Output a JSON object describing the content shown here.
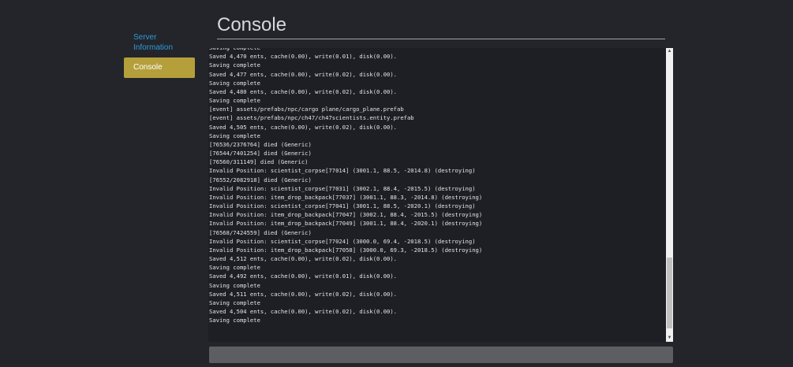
{
  "sidebar": {
    "items": [
      {
        "label": "Server Information",
        "active": false
      },
      {
        "label": "Console",
        "active": true
      }
    ]
  },
  "page": {
    "title": "Console"
  },
  "console": {
    "lines": [
      "Saving complete",
      "Saved 4,470 ents, cache(0.00), write(0.01), disk(0.00).",
      "Saving complete",
      "Saved 4,477 ents, cache(0.00), write(0.02), disk(0.00).",
      "Saving complete",
      "Saved 4,480 ents, cache(0.00), write(0.02), disk(0.00).",
      "Saving complete",
      "[event] assets/prefabs/npc/cargo plane/cargo_plane.prefab",
      "[event] assets/prefabs/npc/ch47/ch47scientists.entity.prefab",
      "Saved 4,505 ents, cache(0.00), write(0.02), disk(0.00).",
      "Saving complete",
      "[76536/2376764] died (Generic)",
      "[76544/7401254] died (Generic)",
      "[76560/311149] died (Generic)",
      "Invalid Position: scientist_corpse[77014] (3001.1, 88.5, -2014.8) (destroying)",
      "[76552/2082918] died (Generic)",
      "Invalid Position: scientist_corpse[77031] (3002.1, 88.4, -2015.5) (destroying)",
      "Invalid Position: item_drop_backpack[77037] (3001.1, 88.3, -2014.8) (destroying)",
      "Invalid Position: scientist_corpse[77041] (3001.1, 88.5, -2020.1) (destroying)",
      "Invalid Position: item_drop_backpack[77047] (3002.1, 88.4, -2015.5) (destroying)",
      "Invalid Position: item_drop_backpack[77049] (3001.1, 88.4, -2020.1) (destroying)",
      "[76568/7424559] died (Generic)",
      "Invalid Position: scientist_corpse[77024] (3000.0, 69.4, -2018.5) (destroying)",
      "Invalid Position: item_drop_backpack[77058] (3000.0, 69.3, -2018.5) (destroying)",
      "Saved 4,512 ents, cache(0.00), write(0.02), disk(0.00).",
      "Saving complete",
      "Saved 4,492 ents, cache(0.00), write(0.01), disk(0.00).",
      "Saving complete",
      "Saved 4,511 ents, cache(0.00), write(0.02), disk(0.00).",
      "Saving complete",
      "Saved 4,504 ents, cache(0.00), write(0.02), disk(0.00).",
      "Saving complete"
    ],
    "scroll_position": 0.97
  },
  "command_input": {
    "value": "",
    "placeholder": ""
  },
  "colors": {
    "background": "#23252b",
    "accent": "#b59f3b",
    "link": "#2f9ad8"
  }
}
